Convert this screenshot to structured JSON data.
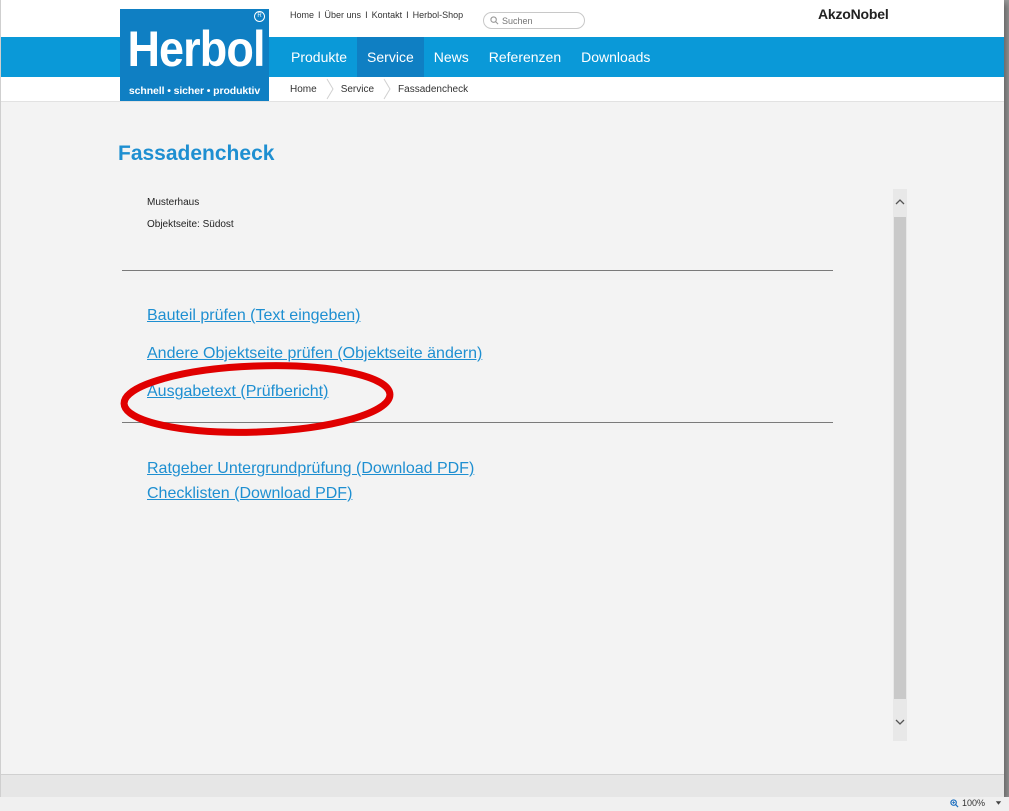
{
  "top_links": [
    "Home",
    "Über uns",
    "Kontakt",
    "Herbol-Shop"
  ],
  "top_link_separator": "I",
  "search": {
    "placeholder": "Suchen"
  },
  "partner_brand": "AkzoNobel",
  "logo": {
    "word": "Herbol",
    "tagline": "schnell • sicher • produktiv",
    "registered": "R"
  },
  "nav": [
    {
      "label": "Produkte",
      "active": false
    },
    {
      "label": "Service",
      "active": true
    },
    {
      "label": "News",
      "active": false
    },
    {
      "label": "Referenzen",
      "active": false
    },
    {
      "label": "Downloads",
      "active": false
    }
  ],
  "breadcrumb": [
    "Home",
    "Service",
    "Fassadencheck"
  ],
  "main": {
    "title": "Fassadencheck",
    "object_name": "Musterhaus",
    "object_side": "Objektseite: Südost",
    "actions": [
      "Bauteil prüfen (Text eingeben)",
      "Andere Objektseite prüfen (Objektseite ändern)",
      "Ausgabetext (Prüfbericht)"
    ],
    "downloads": [
      "Ratgeber Untergrundprüfung (Download PDF)",
      "Checklisten (Download PDF)"
    ]
  },
  "browser": {
    "zoom_label": "100%"
  },
  "colors": {
    "brand_blue": "#0a99d8",
    "nav_active": "#0f7fc3",
    "link": "#1e8fd1",
    "annotation_red": "#e00000"
  }
}
